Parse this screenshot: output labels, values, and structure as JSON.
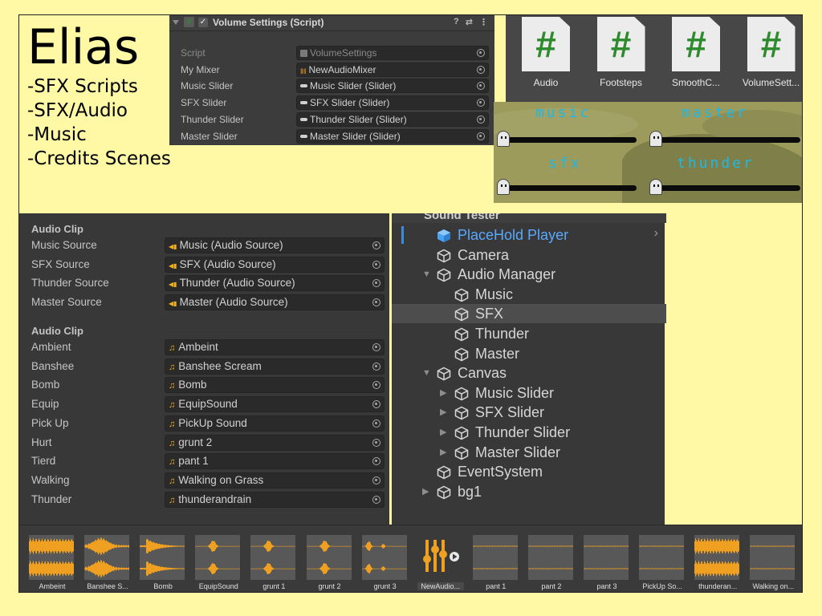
{
  "title": {
    "name": "Elias",
    "items": [
      "-SFX Scripts",
      "-SFX/Audio",
      "-Music",
      "-Credits Scenes"
    ]
  },
  "volume_settings": {
    "header": "Volume Settings (Script)",
    "rows": [
      {
        "label": "Script",
        "value": "VolumeSettings",
        "icon": "script-file-icon"
      },
      {
        "label": "My Mixer",
        "value": "NewAudioMixer",
        "icon": "mixer-icon"
      },
      {
        "label": "Music Slider",
        "value": "Music Slider (Slider)",
        "icon": "slider-icon"
      },
      {
        "label": "SFX Slider",
        "value": "SFX Slider (Slider)",
        "icon": "slider-icon"
      },
      {
        "label": "Thunder Slider",
        "value": "Thunder Slider (Slider)",
        "icon": "slider-icon"
      },
      {
        "label": "Master Slider",
        "value": "Master Slider (Slider)",
        "icon": "slider-icon"
      }
    ]
  },
  "scripts": [
    "Audio",
    "Footsteps",
    "SmoothC...",
    "VolumeSett..."
  ],
  "game_view": {
    "labels": [
      "music",
      "master",
      "sfx",
      "thunder"
    ]
  },
  "audio_manager": {
    "section1": "Audio Clip",
    "sources": [
      {
        "label": "Music Source",
        "value": "Music (Audio Source)"
      },
      {
        "label": "SFX Source",
        "value": "SFX (Audio Source)"
      },
      {
        "label": "Thunder Source",
        "value": "Thunder (Audio Source)"
      },
      {
        "label": "Master Source",
        "value": "Master (Audio Source)"
      }
    ],
    "section2": "Audio Clip",
    "clips": [
      {
        "label": "Ambient",
        "value": "Ambeint"
      },
      {
        "label": "Banshee",
        "value": "Banshee Scream"
      },
      {
        "label": "Bomb",
        "value": "Bomb"
      },
      {
        "label": "Equip",
        "value": "EquipSound"
      },
      {
        "label": "Pick Up",
        "value": "PickUp Sound"
      },
      {
        "label": "Hurt",
        "value": "grunt 2"
      },
      {
        "label": "Tierd",
        "value": "pant 1"
      },
      {
        "label": "Walking",
        "value": "Walking on Grass"
      },
      {
        "label": "Thunder",
        "value": "thunderandrain"
      }
    ]
  },
  "hierarchy": {
    "scene": "Sound Tester",
    "items": [
      {
        "label": "PlaceHold Player",
        "depth": 0,
        "arrow": "",
        "style": "prefab"
      },
      {
        "label": "Camera",
        "depth": 0,
        "arrow": ""
      },
      {
        "label": "Audio Manager",
        "depth": 0,
        "arrow": "open"
      },
      {
        "label": "Music",
        "depth": 1,
        "arrow": ""
      },
      {
        "label": "SFX",
        "depth": 1,
        "arrow": "",
        "selected": true
      },
      {
        "label": "Thunder",
        "depth": 1,
        "arrow": ""
      },
      {
        "label": "Master",
        "depth": 1,
        "arrow": ""
      },
      {
        "label": "Canvas",
        "depth": 0,
        "arrow": "open"
      },
      {
        "label": "Music Slider",
        "depth": 1,
        "arrow": "closed"
      },
      {
        "label": "SFX Slider",
        "depth": 1,
        "arrow": "closed"
      },
      {
        "label": "Thunder Slider",
        "depth": 1,
        "arrow": "closed"
      },
      {
        "label": "Master Slider",
        "depth": 1,
        "arrow": "closed"
      },
      {
        "label": "EventSystem",
        "depth": 0,
        "arrow": ""
      },
      {
        "label": "bg1",
        "depth": 0,
        "arrow": "closed"
      }
    ]
  },
  "assets": [
    {
      "name": "Ambeint",
      "kind": "wave-dense"
    },
    {
      "name": "Banshee S...",
      "kind": "wave-mid"
    },
    {
      "name": "Bomb",
      "kind": "wave-burst"
    },
    {
      "name": "EquipSound",
      "kind": "wave-blip"
    },
    {
      "name": "grunt 1",
      "kind": "wave-blip"
    },
    {
      "name": "grunt 2",
      "kind": "wave-blip"
    },
    {
      "name": "grunt 3",
      "kind": "wave-sparse"
    },
    {
      "name": "NewAudio...",
      "kind": "mixer",
      "selected": true
    },
    {
      "name": "pant 1",
      "kind": "wave-flat"
    },
    {
      "name": "pant 2",
      "kind": "wave-flat"
    },
    {
      "name": "pant 3",
      "kind": "wave-flat"
    },
    {
      "name": "PickUp So...",
      "kind": "wave-flat"
    },
    {
      "name": "thunderan...",
      "kind": "wave-dense"
    },
    {
      "name": "Walking on...",
      "kind": "wave-flat"
    }
  ],
  "colors": {
    "slide_bg": "#fff9a6",
    "panel_bg": "#383838",
    "accent_orange": "#f0a020",
    "script_green": "#2d8b2d",
    "hierarchy_blue": "#5aa8ff",
    "game_label_cyan": "#1fb8e3"
  }
}
